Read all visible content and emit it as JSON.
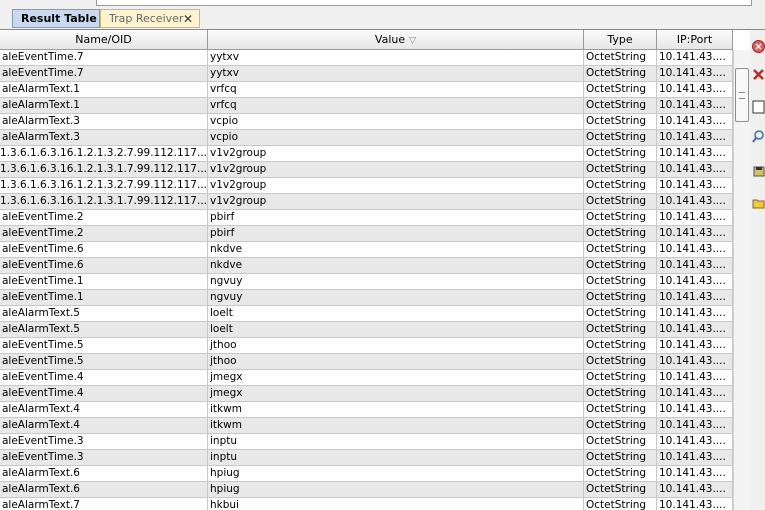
{
  "tabs": [
    {
      "label": "Result Table",
      "active": true
    },
    {
      "label": "Trap Receiver",
      "active": false,
      "close": "✕"
    }
  ],
  "table": {
    "columns": [
      "Name/OID",
      "Value",
      "Type",
      "IP:Port"
    ],
    "sort_indicator": "▽",
    "rows": [
      [
        "aleEventTime.7",
        "yytxv",
        "OctetString",
        "10.141.43...."
      ],
      [
        "aleEventTime.7",
        "yytxv",
        "OctetString",
        "10.141.43...."
      ],
      [
        "aleAlarmText.1",
        "vrfcq",
        "OctetString",
        "10.141.43...."
      ],
      [
        "aleAlarmText.1",
        "vrfcq",
        "OctetString",
        "10.141.43...."
      ],
      [
        "aleAlarmText.3",
        "vcpio",
        "OctetString",
        "10.141.43...."
      ],
      [
        "aleAlarmText.3",
        "vcpio",
        "OctetString",
        "10.141.43...."
      ],
      [
        ".1.3.6.1.6.3.16.1.2.1.3.2.7.99.112.117...",
        "v1v2group",
        "OctetString",
        "10.141.43...."
      ],
      [
        ".1.3.6.1.6.3.16.1.2.1.3.1.7.99.112.117...",
        "v1v2group",
        "OctetString",
        "10.141.43...."
      ],
      [
        ".1.3.6.1.6.3.16.1.2.1.3.2.7.99.112.117...",
        "v1v2group",
        "OctetString",
        "10.141.43...."
      ],
      [
        ".1.3.6.1.6.3.16.1.2.1.3.1.7.99.112.117...",
        "v1v2group",
        "OctetString",
        "10.141.43...."
      ],
      [
        "aleEventTime.2",
        "pbirf",
        "OctetString",
        "10.141.43...."
      ],
      [
        "aleEventTime.2",
        "pbirf",
        "OctetString",
        "10.141.43...."
      ],
      [
        "aleEventTime.6",
        "nkdve",
        "OctetString",
        "10.141.43...."
      ],
      [
        "aleEventTime.6",
        "nkdve",
        "OctetString",
        "10.141.43...."
      ],
      [
        "aleEventTime.1",
        "ngvuy",
        "OctetString",
        "10.141.43...."
      ],
      [
        "aleEventTime.1",
        "ngvuy",
        "OctetString",
        "10.141.43...."
      ],
      [
        "aleAlarmText.5",
        "loelt",
        "OctetString",
        "10.141.43...."
      ],
      [
        "aleAlarmText.5",
        "loelt",
        "OctetString",
        "10.141.43...."
      ],
      [
        "aleEventTime.5",
        "jthoo",
        "OctetString",
        "10.141.43...."
      ],
      [
        "aleEventTime.5",
        "jthoo",
        "OctetString",
        "10.141.43...."
      ],
      [
        "aleEventTime.4",
        "jmegx",
        "OctetString",
        "10.141.43...."
      ],
      [
        "aleEventTime.4",
        "jmegx",
        "OctetString",
        "10.141.43...."
      ],
      [
        "aleAlarmText.4",
        "itkwm",
        "OctetString",
        "10.141.43...."
      ],
      [
        "aleAlarmText.4",
        "itkwm",
        "OctetString",
        "10.141.43...."
      ],
      [
        "aleEventTime.3",
        "inptu",
        "OctetString",
        "10.141.43...."
      ],
      [
        "aleEventTime.3",
        "inptu",
        "OctetString",
        "10.141.43...."
      ],
      [
        "aleAlarmText.6",
        "hpiug",
        "OctetString",
        "10.141.43...."
      ],
      [
        "aleAlarmText.6",
        "hpiug",
        "OctetString",
        "10.141.43...."
      ],
      [
        "aleAlarmText.7",
        "hkbui",
        "OctetString",
        "10.141.43...."
      ]
    ]
  },
  "side_toolbar": {
    "icons": [
      "stop-icon",
      "delete-icon",
      "window-icon",
      "search-icon",
      "save-icon",
      "open-folder-icon"
    ]
  }
}
